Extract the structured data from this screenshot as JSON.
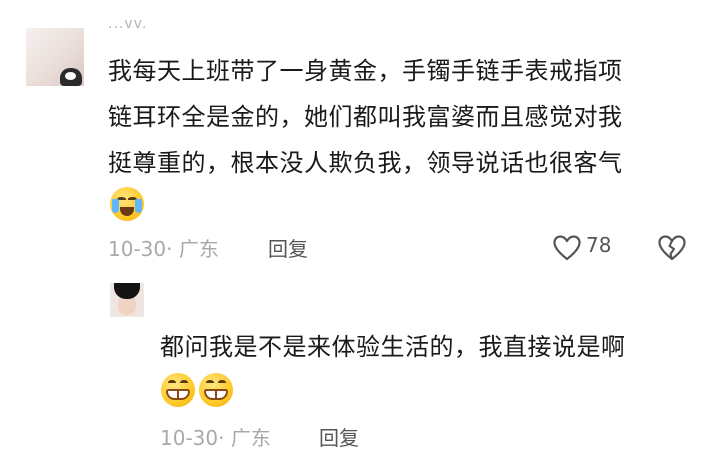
{
  "main_comment": {
    "username": "...vv.",
    "text_lines": [
      "我每天上班带了一身黄金，手镯手链手表戒指项",
      "链耳环全是金的，她们都叫我富婆而且感觉对我",
      "挺尊重的，根本没人欺负我，领导说话也很客气"
    ],
    "emoji": "crying-laughing-emoji",
    "date_location": "10-30· 广东",
    "reply_label": "回复",
    "like_icon": "heart-icon",
    "like_count": "78",
    "dislike_icon": "broken-heart-icon"
  },
  "reply_comment": {
    "text": "都问我是不是来体验生活的，我直接说是啊",
    "emojis": [
      "grinning-emoji",
      "grinning-emoji"
    ],
    "date_location": "10-30· 广东",
    "reply_label": "回复"
  },
  "colors": {
    "meta_gray": "#a9a9a9",
    "action_gray": "#555555",
    "text": "#1a1a1a"
  }
}
